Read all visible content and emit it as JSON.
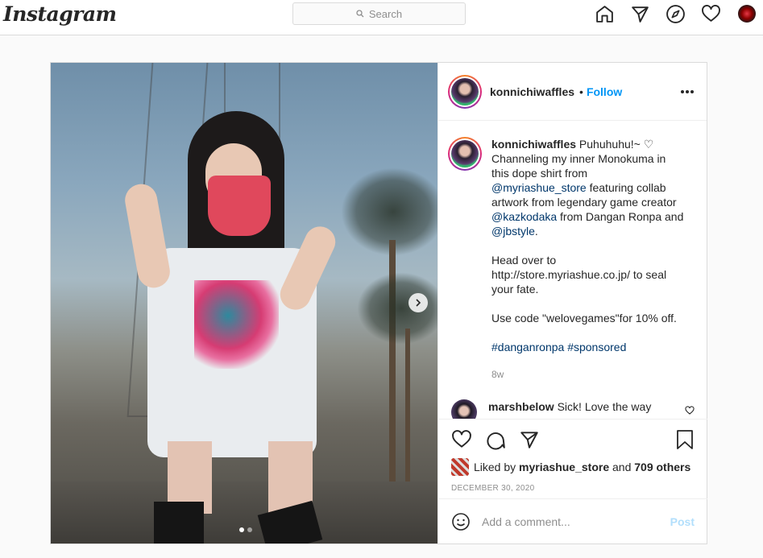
{
  "header": {
    "logo": "Instagram",
    "search_placeholder": "Search",
    "icons": [
      "home-icon",
      "direct-icon",
      "explore-icon",
      "activity-heart-icon",
      "profile-avatar"
    ]
  },
  "post": {
    "username": "konnichiwaffles",
    "separator": "•",
    "follow_label": "Follow",
    "carousel": {
      "current": 1,
      "total": 2
    },
    "caption": {
      "username": "konnichiwaffles",
      "lines": [
        "Puhuhuhu!~ ♡",
        "Channeling my inner Monokuma in",
        "this dope shirt from"
      ],
      "mention1": "@myriashue_store",
      "after_mention1": " featuring collab artwork from legendary game creator ",
      "mention2": "@kazkodaka",
      "after_mention2": " from Dangan Ronpa and ",
      "mention3": "@jbstyle",
      "after_mention3": ".",
      "para2": "Head over to http://store.myriashue.co.jp/ to seal your fate.",
      "para3": "Use code \"welovegames\"for 10% off.",
      "hashtags": "#danganronpa #sponsored",
      "time": "8w"
    },
    "comments": [
      {
        "username": "marshbelow",
        "text": "Sick! Love the way"
      }
    ],
    "likes": {
      "prefix": "Liked by",
      "user": "myriashue_store",
      "and": "and",
      "others": "709 others"
    },
    "date": "DECEMBER 30, 2020",
    "add_comment_placeholder": "Add a comment...",
    "post_button": "Post"
  },
  "colors": {
    "link_blue": "#0095f6",
    "mention_blue": "#00376b",
    "muted": "#8e8e8e",
    "border": "#dbdbdb"
  }
}
